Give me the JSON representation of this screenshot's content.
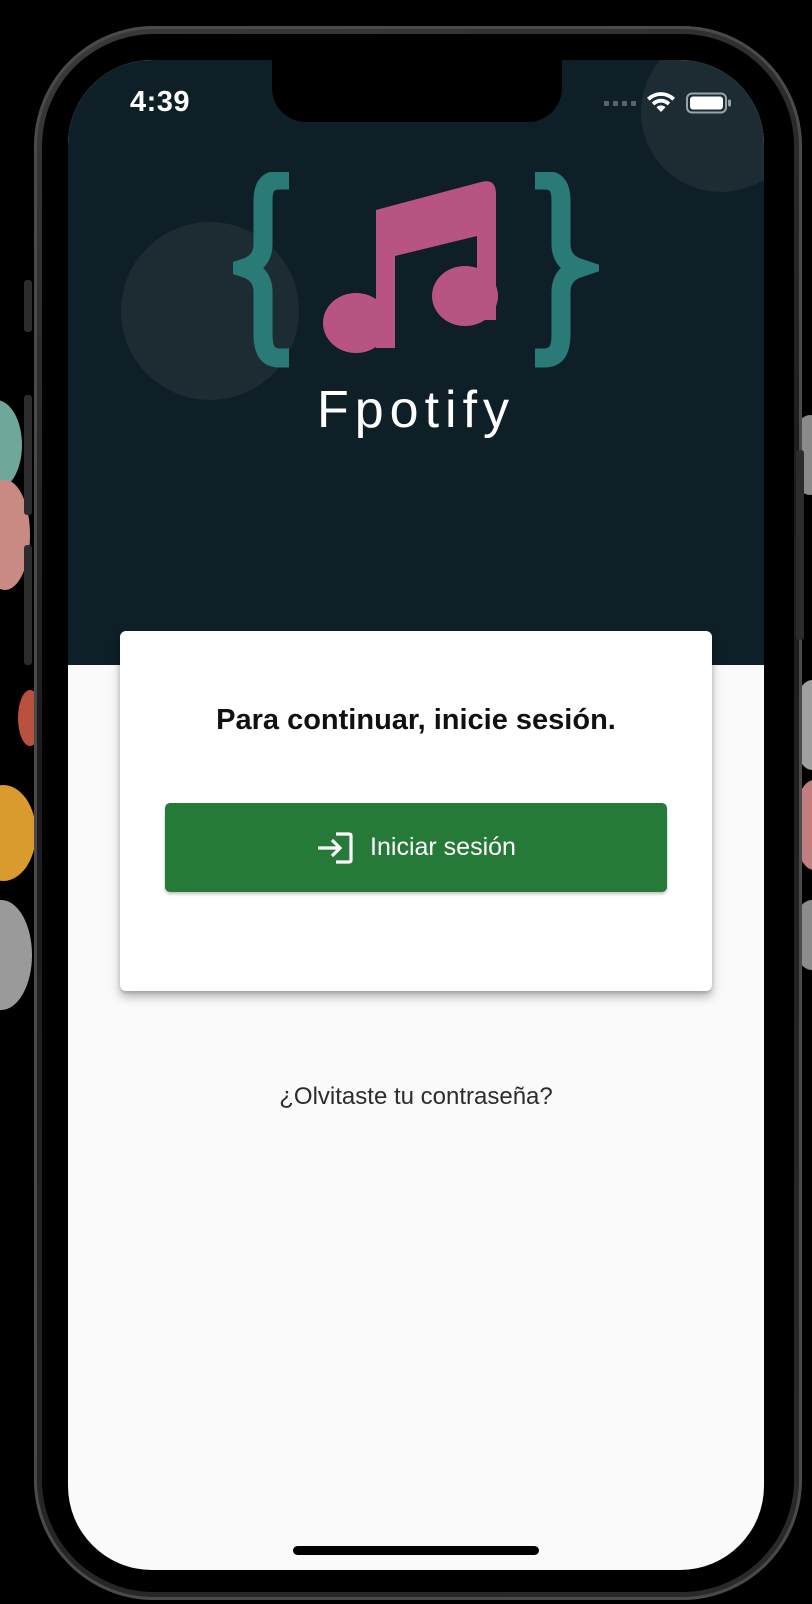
{
  "status_bar": {
    "time": "4:39",
    "icons": [
      "signal-icon",
      "wifi-icon",
      "battery-icon"
    ]
  },
  "brand": {
    "name": "Fpotify",
    "logo_icon": "music-note-braces-logo",
    "colors": {
      "brace": "#2a7b78",
      "note": "#b85482",
      "header_bg": "#0f1f27"
    }
  },
  "login_card": {
    "title": "Para continuar, inicie sesión.",
    "button": {
      "label": "Iniciar sesión",
      "icon": "login-icon",
      "color": "#267a38"
    }
  },
  "forgot_password": {
    "label": "¿Olvitaste tu contraseña?"
  }
}
